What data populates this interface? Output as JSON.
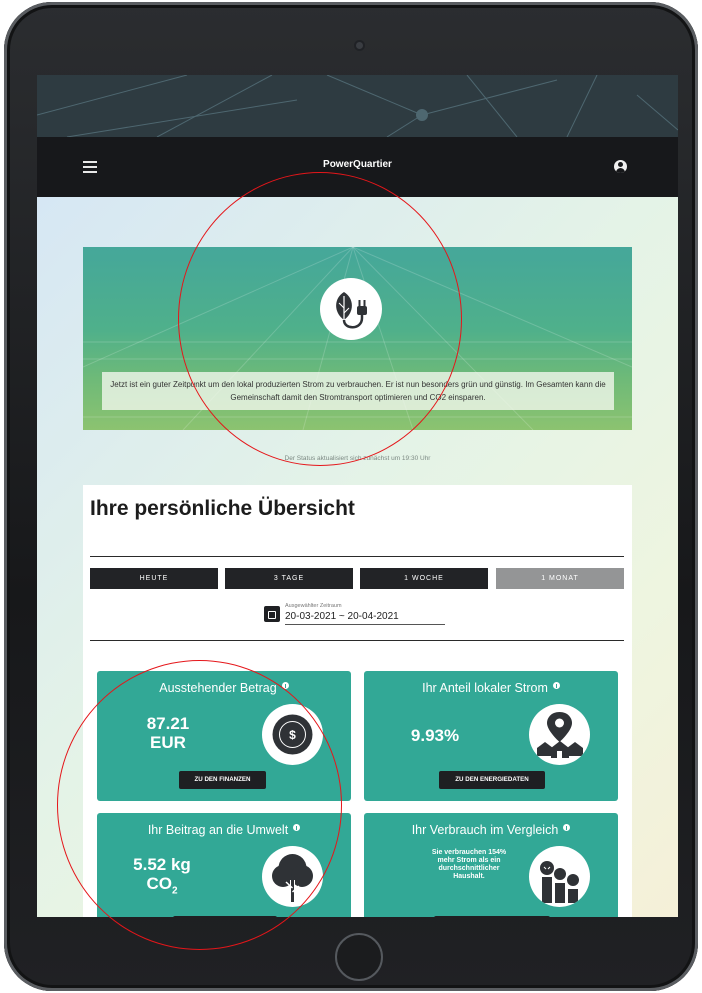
{
  "app": {
    "title": "PowerQuartier"
  },
  "banner": {
    "message": "Jetzt ist ein guter Zeitpunkt um den lokal produzierten Strom zu verbrauchen. Er ist nun besonders grün und günstig. Im Gesamten kann die Gemeinschaft damit den Stromtransport optimieren und CO2 einsparen.",
    "icon": "leaf-plug-icon"
  },
  "status_note": "Der Status aktualisiert sich zunächst um 19:30 Uhr",
  "overview": {
    "title": "Ihre persönliche Übersicht",
    "tabs": [
      {
        "label": "HEUTE",
        "active": false
      },
      {
        "label": "3 TAGE",
        "active": false
      },
      {
        "label": "1 WOCHE",
        "active": false
      },
      {
        "label": "1 MONAT",
        "active": true
      }
    ],
    "period": {
      "label": "Ausgewählter Zeitraum",
      "value": "20-03-2021 ~ 20-04-2021"
    }
  },
  "tiles": {
    "amount": {
      "title": "Ausstehender Betrag",
      "value_line1": "87.21",
      "value_line2": "EUR",
      "button": "ZU DEN FINANZEN",
      "icon": "dollar-icon"
    },
    "local_share": {
      "title": "Ihr Anteil lokaler Strom",
      "value": "9.93%",
      "button": "ZU DEN ENERGIEDATEN",
      "icon": "location-houses-icon"
    },
    "environment": {
      "title": "Ihr Beitrag an die Umwelt",
      "value_line1": "5.52 kg",
      "value_line2": "CO",
      "value_sub": "2",
      "icon": "tree-icon"
    },
    "comparison": {
      "title": "Ihr Verbrauch im Vergleich",
      "text": "Sie verbrauchen 154% mehr Strom als ein durchschnittlicher Haushalt.",
      "icon": "people-bars-icon"
    }
  },
  "colors": {
    "accent": "#32a896",
    "appbar": "#17181b",
    "annotation": "#e5161a"
  }
}
